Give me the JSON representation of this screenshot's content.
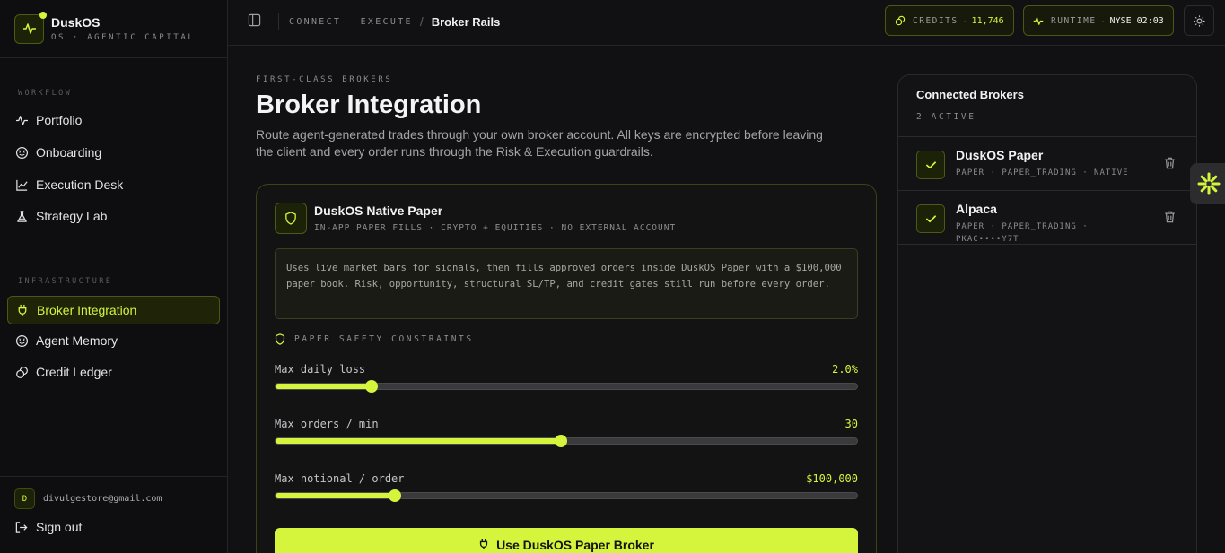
{
  "brand": {
    "name": "DuskOS",
    "tagline": "OS · AGENTIC CAPITAL"
  },
  "sidebar": {
    "workflow_heading": "WORKFLOW",
    "workflow": [
      {
        "label": "Portfolio",
        "icon": "pulse-icon"
      },
      {
        "label": "Onboarding",
        "icon": "brain-icon"
      },
      {
        "label": "Execution Desk",
        "icon": "chart-line-icon"
      },
      {
        "label": "Strategy Lab",
        "icon": "flask-icon"
      }
    ],
    "infra_heading": "INFRASTRUCTURE",
    "infra": [
      {
        "label": "Broker Integration",
        "icon": "plug-icon",
        "active": true
      },
      {
        "label": "Agent Memory",
        "icon": "brain-icon"
      },
      {
        "label": "Credit Ledger",
        "icon": "coins-icon"
      }
    ],
    "user": {
      "initial": "D",
      "email": "divulgestore@gmail.com"
    },
    "signout_label": "Sign out"
  },
  "topbar": {
    "crumbs": [
      "CONNECT",
      "EXECUTE"
    ],
    "crumb_sep": "·",
    "crumb_slash": "/",
    "current": "Broker Rails",
    "credits": {
      "label": "CREDITS",
      "sep": "·",
      "value": "11,746"
    },
    "runtime": {
      "label": "RUNTIME",
      "sep": "·",
      "value": "NYSE 02:03"
    }
  },
  "main": {
    "eyebrow": "FIRST-CLASS BROKERS",
    "title": "Broker Integration",
    "description": "Route agent-generated trades through your own broker account. All keys are encrypted before leaving the client and every order runs through the Risk & Execution guardrails.",
    "card": {
      "title": "DuskOS Native Paper",
      "subtitle": "IN-APP PAPER FILLS · CRYPTO + EQUITIES · NO EXTERNAL ACCOUNT",
      "info": "Uses live market bars for signals, then fills approved orders inside DuskOS Paper with a $100,000 paper book. Risk, opportunity, structural SL/TP, and credit gates still run before every order.",
      "constraints_heading": "PAPER SAFETY CONSTRAINTS",
      "sliders": [
        {
          "label": "Max daily loss",
          "value": "2.0%",
          "level": 0.165
        },
        {
          "label": "Max orders / min",
          "value": "30",
          "level": 0.491
        },
        {
          "label": "Max notional / order",
          "value": "$100,000",
          "level": 0.206
        }
      ],
      "button_label": "Use DuskOS Paper Broker"
    }
  },
  "panel": {
    "title": "Connected Brokers",
    "subtitle": "2 ACTIVE",
    "brokers": [
      {
        "name": "DuskOS Paper",
        "meta": "PAPER · PAPER_TRADING · NATIVE"
      },
      {
        "name": "Alpaca",
        "meta": "PAPER · PAPER_TRADING · PKAC••••Y7T"
      }
    ]
  },
  "colors": {
    "accent": "#d4f53c",
    "background": "#111113",
    "sidebar": "#0e0e10"
  }
}
